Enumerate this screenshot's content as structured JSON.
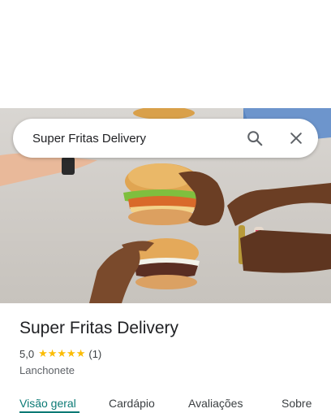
{
  "search": {
    "query": "Super Fritas Delivery",
    "search_icon": "search-icon",
    "close_icon": "close-icon"
  },
  "hero": {
    "image_subject": "burgers-held-in-hands"
  },
  "place": {
    "name": "Super Fritas Delivery",
    "rating": "5,0",
    "stars": "★★★★★",
    "stars_value": 5,
    "review_count": "(1)",
    "category": "Lanchonete"
  },
  "tabs": [
    {
      "label": "Visão geral",
      "active": true
    },
    {
      "label": "Cardápio",
      "active": false
    },
    {
      "label": "Avaliações",
      "active": false
    },
    {
      "label": "Sobre",
      "active": false
    }
  ],
  "colors": {
    "accent": "#0b7a75",
    "star": "#fbbc04",
    "title": "#202124"
  }
}
